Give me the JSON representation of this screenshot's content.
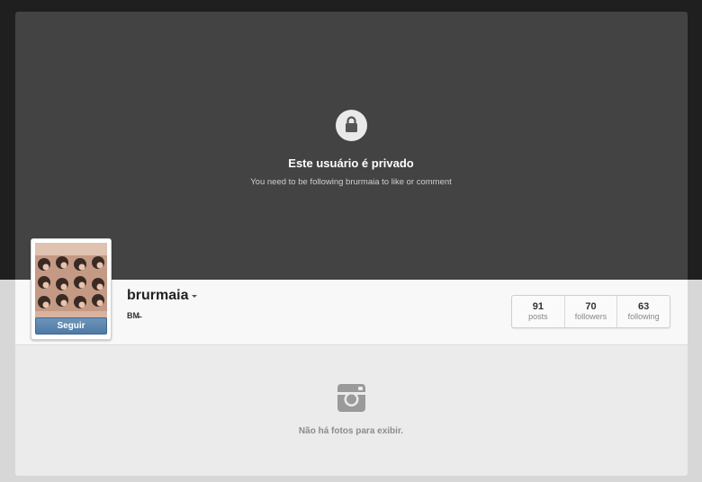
{
  "private_notice": {
    "icon": "lock-icon",
    "title": "Este usuário é privado",
    "subtitle": "You need to be following brurmaia to like or comment"
  },
  "profile": {
    "username": "brurmaia",
    "bio": "BM̶",
    "follow_label": "Seguir"
  },
  "stats": [
    {
      "value": "91",
      "label": "posts"
    },
    {
      "value": "70",
      "label": "followers"
    },
    {
      "value": "63",
      "label": "following"
    }
  ],
  "empty_state": {
    "icon": "camera-icon",
    "message": "Não há fotos para exibir."
  },
  "colors": {
    "header_bg": "#434343",
    "follow_button": "#5a84ad",
    "page_bg": "#1f1f1f"
  }
}
